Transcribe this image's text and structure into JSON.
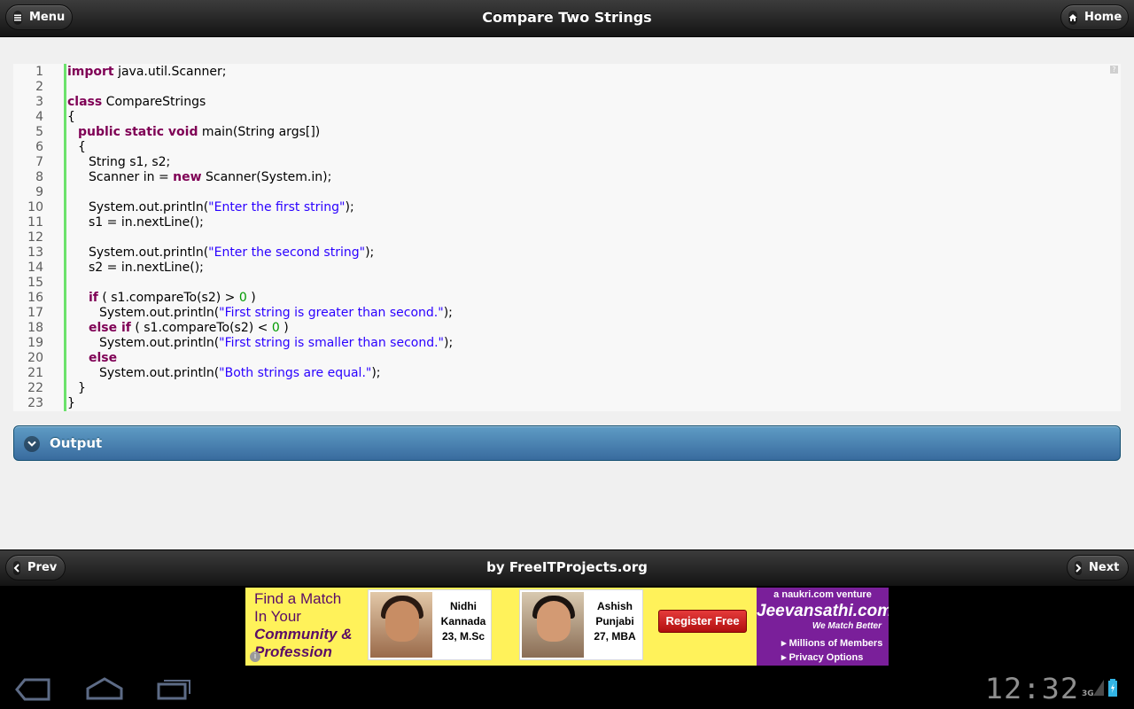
{
  "header": {
    "title": "Compare Two Strings",
    "menu_label": "Menu",
    "home_label": "Home"
  },
  "code": {
    "help_mark": "?",
    "lines": [
      {
        "n": "1",
        "indent": 0,
        "tokens": [
          {
            "t": "import",
            "c": "kw"
          },
          {
            "t": " java.util.Scanner;",
            "c": ""
          }
        ]
      },
      {
        "n": "2",
        "indent": 0,
        "tokens": []
      },
      {
        "n": "3",
        "indent": 0,
        "tokens": [
          {
            "t": "class",
            "c": "kw"
          },
          {
            "t": " CompareStrings",
            "c": ""
          }
        ]
      },
      {
        "n": "4",
        "indent": 0,
        "tokens": [
          {
            "t": "{",
            "c": ""
          }
        ]
      },
      {
        "n": "5",
        "indent": 1,
        "tokens": [
          {
            "t": "public static void",
            "c": "kw"
          },
          {
            "t": " main(String args[])",
            "c": ""
          }
        ]
      },
      {
        "n": "6",
        "indent": 1,
        "tokens": [
          {
            "t": "{",
            "c": ""
          }
        ]
      },
      {
        "n": "7",
        "indent": 2,
        "tokens": [
          {
            "t": "String s1, s2;",
            "c": ""
          }
        ]
      },
      {
        "n": "8",
        "indent": 2,
        "tokens": [
          {
            "t": "Scanner in = ",
            "c": ""
          },
          {
            "t": "new",
            "c": "kw"
          },
          {
            "t": " Scanner(System.in);",
            "c": ""
          }
        ]
      },
      {
        "n": "9",
        "indent": 0,
        "tokens": []
      },
      {
        "n": "10",
        "indent": 2,
        "tokens": [
          {
            "t": "System.out.println(",
            "c": ""
          },
          {
            "t": "\"Enter the first string\"",
            "c": "str"
          },
          {
            "t": ");",
            "c": ""
          }
        ]
      },
      {
        "n": "11",
        "indent": 2,
        "tokens": [
          {
            "t": "s1 = in.nextLine();",
            "c": ""
          }
        ]
      },
      {
        "n": "12",
        "indent": 0,
        "tokens": []
      },
      {
        "n": "13",
        "indent": 2,
        "tokens": [
          {
            "t": "System.out.println(",
            "c": ""
          },
          {
            "t": "\"Enter the second string\"",
            "c": "str"
          },
          {
            "t": ");",
            "c": ""
          }
        ]
      },
      {
        "n": "14",
        "indent": 2,
        "tokens": [
          {
            "t": "s2 = in.nextLine();",
            "c": ""
          }
        ]
      },
      {
        "n": "15",
        "indent": 0,
        "tokens": []
      },
      {
        "n": "16",
        "indent": 2,
        "tokens": [
          {
            "t": "if",
            "c": "kw"
          },
          {
            "t": " ( s1.compareTo(s2) > ",
            "c": ""
          },
          {
            "t": "0",
            "c": "num"
          },
          {
            "t": " )",
            "c": ""
          }
        ]
      },
      {
        "n": "17",
        "indent": 3,
        "tokens": [
          {
            "t": "System.out.println(",
            "c": ""
          },
          {
            "t": "\"First string is greater than second.\"",
            "c": "str"
          },
          {
            "t": ");",
            "c": ""
          }
        ]
      },
      {
        "n": "18",
        "indent": 2,
        "tokens": [
          {
            "t": "else if",
            "c": "kw"
          },
          {
            "t": " ( s1.compareTo(s2) < ",
            "c": ""
          },
          {
            "t": "0",
            "c": "num"
          },
          {
            "t": " )",
            "c": ""
          }
        ]
      },
      {
        "n": "19",
        "indent": 3,
        "tokens": [
          {
            "t": "System.out.println(",
            "c": ""
          },
          {
            "t": "\"First string is smaller than second.\"",
            "c": "str"
          },
          {
            "t": ");",
            "c": ""
          }
        ]
      },
      {
        "n": "20",
        "indent": 2,
        "tokens": [
          {
            "t": "else",
            "c": "kw"
          }
        ]
      },
      {
        "n": "21",
        "indent": 3,
        "tokens": [
          {
            "t": "System.out.println(",
            "c": ""
          },
          {
            "t": "\"Both strings are equal.\"",
            "c": "str"
          },
          {
            "t": ");",
            "c": ""
          }
        ]
      },
      {
        "n": "22",
        "indent": 1,
        "tokens": [
          {
            "t": "}",
            "c": ""
          }
        ]
      },
      {
        "n": "23",
        "indent": 0,
        "tokens": [
          {
            "t": "}",
            "c": ""
          }
        ]
      }
    ]
  },
  "output": {
    "label": "Output",
    "collapsed": true
  },
  "footer": {
    "title": "by FreeITProjects.org",
    "prev_label": "Prev",
    "next_label": "Next"
  },
  "ad": {
    "headline_1": "Find a Match",
    "headline_2": "In Your",
    "headline_3": "Community &",
    "headline_4": "Profession",
    "profile_1": {
      "name": "Nidhi",
      "community": "Kannada",
      "details": "23, M.Sc"
    },
    "profile_2": {
      "name": "Ashish",
      "community": "Punjabi",
      "details": "27, MBA"
    },
    "cta": "Register Free",
    "venture": "a naukri.com venture",
    "brand": "Jeevansathi.com",
    "tagline": "We Match Better",
    "bullet_1": "Millions of Members",
    "bullet_2": "Privacy Options",
    "info_mark": "i"
  },
  "system_bar": {
    "time": "12:32",
    "network": "3G"
  },
  "colors": {
    "keyword": "#7f0055",
    "string": "#2a00ff",
    "number": "#009900",
    "gutter_line": "#6ce26c",
    "output_bar": "#4a83b3"
  }
}
